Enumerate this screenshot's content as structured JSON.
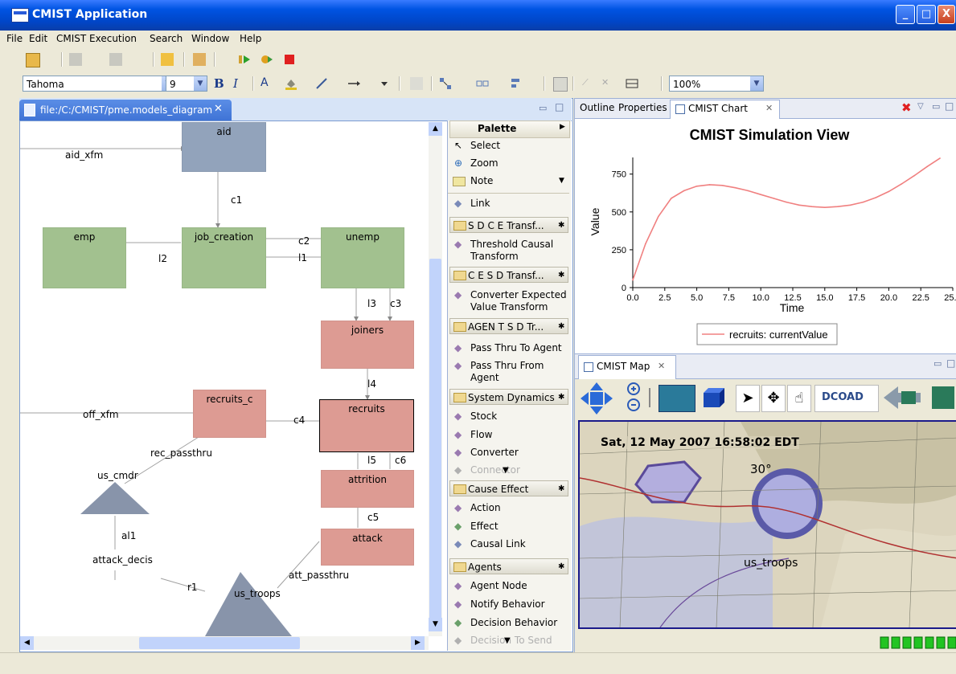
{
  "window": {
    "title": "CMIST Application"
  },
  "menu": [
    "File",
    "Edit",
    "CMIST Execution",
    "Search",
    "Window",
    "Help"
  ],
  "format_toolbar": {
    "font": "Tahoma",
    "size": "9",
    "bold": "B",
    "italic": "I",
    "text_color": "A",
    "zoom": "100%"
  },
  "editor": {
    "tab_label": "file:/C:/CMIST/pme.models_diagram",
    "nodes": [
      {
        "label": "aid"
      },
      {
        "label": "emp"
      },
      {
        "label": "job_creation"
      },
      {
        "label": "unemp"
      },
      {
        "label": "joiners"
      },
      {
        "label": "recruits_c"
      },
      {
        "label": "recruits"
      },
      {
        "label": "attrition"
      },
      {
        "label": "attack"
      }
    ],
    "links": [
      "aid_xfm",
      "c1",
      "c2",
      "l2",
      "l1",
      "l3",
      "c3",
      "l4",
      "c4",
      "off_xfm",
      "rec_passthru",
      "us_cmdr",
      "l5",
      "c6",
      "c5",
      "al1",
      "attack_decis",
      "r1",
      "us_troops",
      "att_passthru"
    ]
  },
  "palette": {
    "title": "Palette",
    "tools": [
      "Select",
      "Zoom",
      "Note"
    ],
    "link": "Link",
    "drawers": [
      {
        "label": "S D C E Transf...",
        "items": [
          "Threshold Causal Transform"
        ]
      },
      {
        "label": "C E S D Transf...",
        "items": [
          "Converter Expected Value Transform"
        ]
      },
      {
        "label": "AGEN T S D Tr...",
        "items": [
          "Pass Thru To Agent",
          "Pass Thru From Agent"
        ]
      },
      {
        "label": "System Dynamics",
        "items": [
          "Stock",
          "Flow",
          "Converter",
          "Connector"
        ]
      },
      {
        "label": "Cause Effect",
        "items": [
          "Action",
          "Effect",
          "Causal Link"
        ]
      },
      {
        "label": "Agents",
        "items": [
          "Agent Node",
          "Notify Behavior",
          "Decision Behavior",
          "Decision To Send"
        ]
      }
    ]
  },
  "views": {
    "outline_tab": "Outline",
    "properties_tab": "Properties",
    "chart_tab": "CMIST Chart",
    "map_tab": "CMIST Map"
  },
  "chart_data": {
    "type": "line",
    "title": "CMIST Simulation View",
    "xlabel": "Time",
    "ylabel": "Value",
    "xlim": [
      0,
      25
    ],
    "ylim": [
      0,
      860
    ],
    "x_ticks": [
      "0.0",
      "2.5",
      "5.0",
      "7.5",
      "10.0",
      "12.5",
      "15.0",
      "17.5",
      "20.0",
      "22.5",
      "25.0"
    ],
    "y_ticks": [
      "0",
      "250",
      "500",
      "750"
    ],
    "series": [
      {
        "name": "recruits: currentValue",
        "color": "#f08080",
        "x": [
          0,
          1,
          2,
          3,
          4,
          5,
          6,
          7,
          8,
          9,
          10,
          11,
          12,
          13,
          14,
          15,
          16,
          17,
          18,
          19,
          20,
          21,
          22,
          23,
          24
        ],
        "y": [
          50,
          290,
          470,
          590,
          640,
          670,
          680,
          675,
          660,
          640,
          615,
          590,
          565,
          545,
          535,
          530,
          535,
          545,
          565,
          595,
          635,
          685,
          740,
          800,
          855
        ]
      }
    ],
    "legend": "bottom",
    "grid": false
  },
  "map": {
    "timestamp": "Sat, 12 May 2007 16:58:02 EDT",
    "label": "us_troops",
    "grid_label": "30°",
    "dcoad_button": "DCOAD"
  }
}
